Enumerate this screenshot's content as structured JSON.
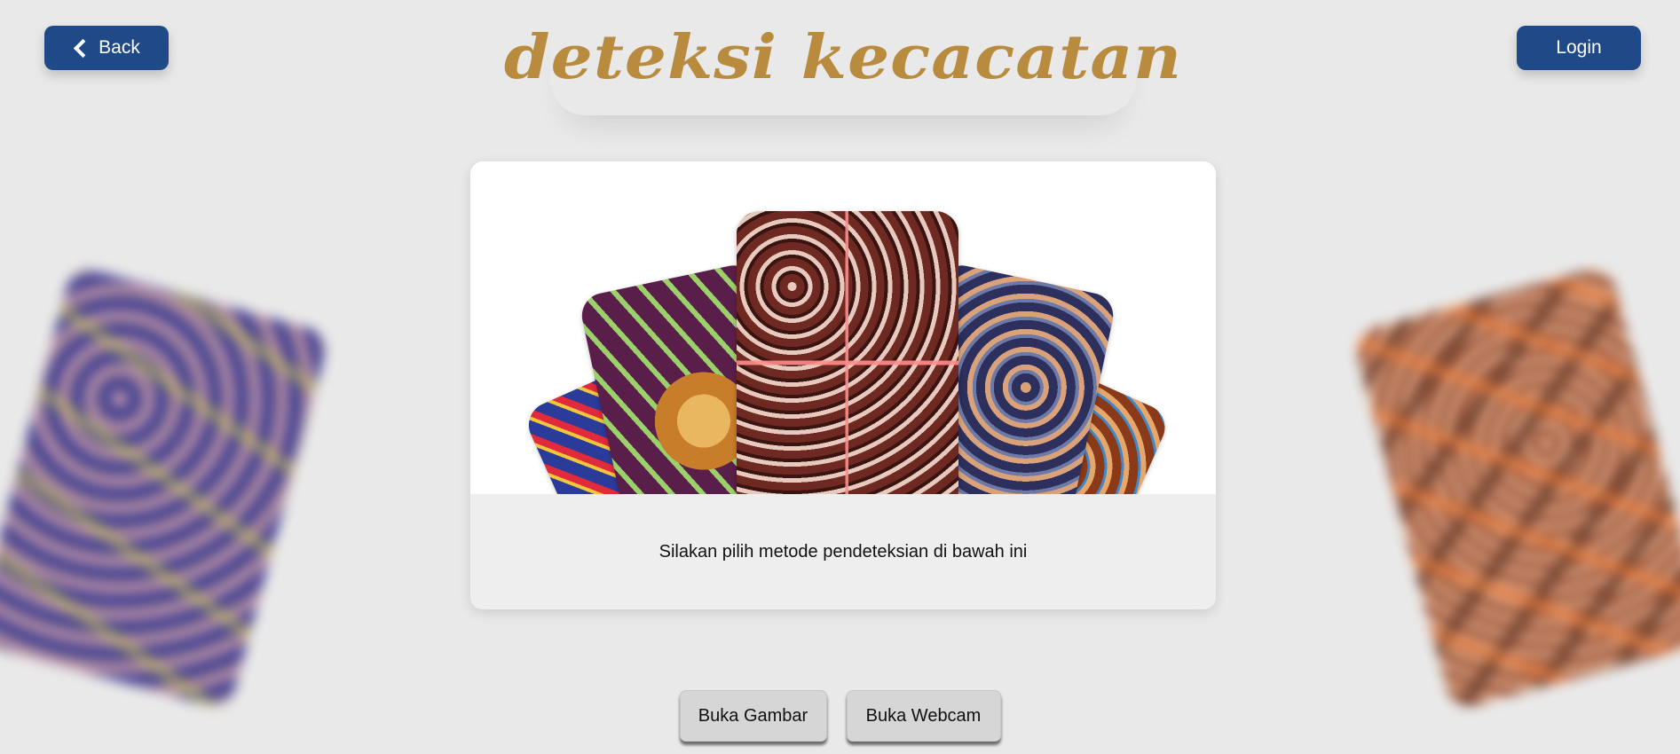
{
  "header": {
    "back_label": "Back",
    "login_label": "Login",
    "title": "deteksi kecacatan"
  },
  "main": {
    "instruction": "Silakan pilih metode pendeteksian di bawah ini"
  },
  "actions": {
    "open_image_label": "Buka Gambar",
    "open_webcam_label": "Buka Webcam"
  },
  "colors": {
    "primary": "#1f4a87",
    "title": "#b88b3e",
    "background": "#e9e9e9"
  }
}
